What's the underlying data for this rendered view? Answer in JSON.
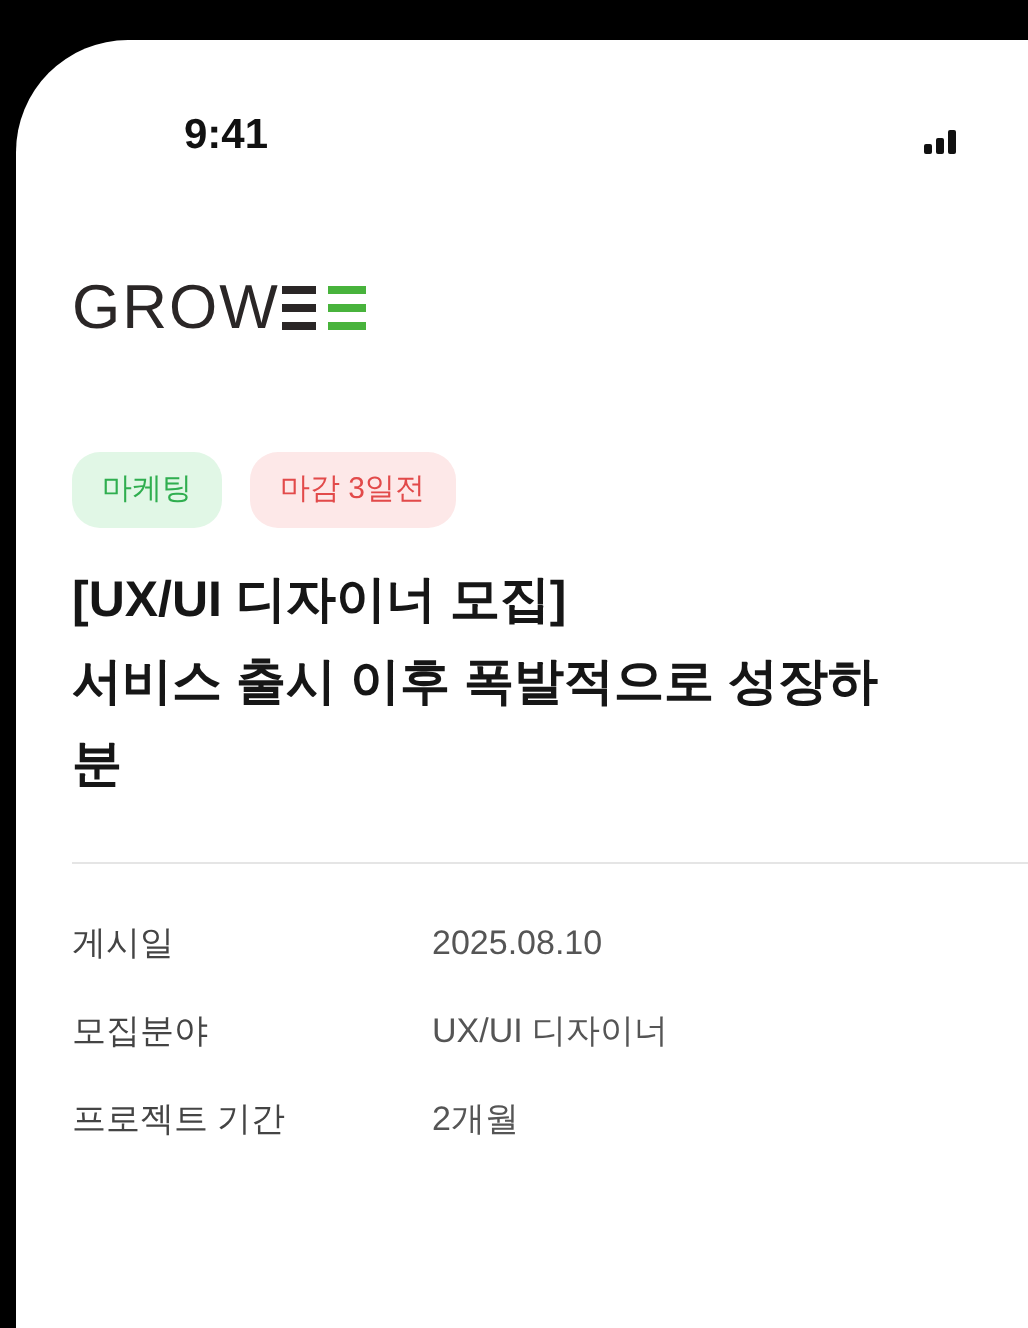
{
  "status_bar": {
    "time": "9:41"
  },
  "logo": {
    "text": "GROW"
  },
  "tags": [
    {
      "label": "마케팅",
      "kind": "category"
    },
    {
      "label": "마감 3일전",
      "kind": "deadline"
    }
  ],
  "title_lines": [
    "[UX/UI 디자이너 모집]",
    "서비스 출시 이후 폭발적으로 성장하",
    "분"
  ],
  "details": [
    {
      "label": "게시일",
      "value": "2025.08.10"
    },
    {
      "label": "모집분야",
      "value": "UX/UI 디자이너"
    },
    {
      "label": "프로젝트 기간",
      "value": "2개월"
    }
  ]
}
